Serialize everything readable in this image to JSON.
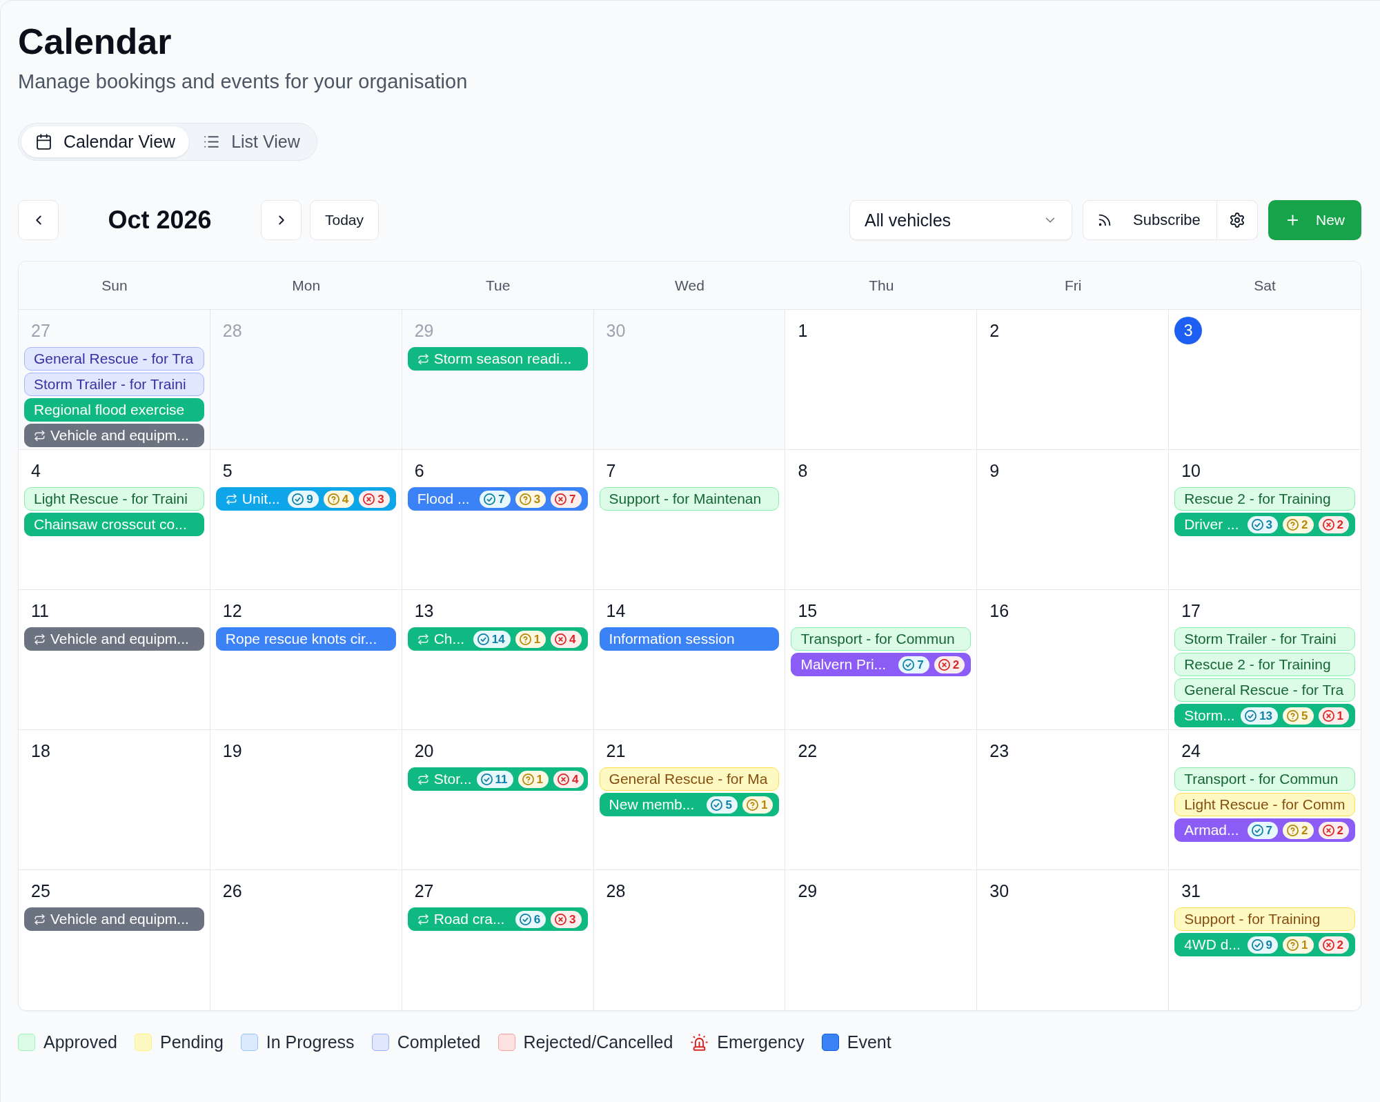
{
  "page": {
    "title": "Calendar",
    "subtitle": "Manage bookings and events for your organisation"
  },
  "view_toggle": [
    {
      "label": "Calendar View",
      "kind": "calendar",
      "selected": true
    },
    {
      "label": "List View",
      "kind": "list",
      "selected": false
    }
  ],
  "toolbar": {
    "month": "Oct 2026",
    "today_button": "Today",
    "vehicle_filter": {
      "value": "All vehicles"
    },
    "subscribe_button": "Subscribe",
    "new_button": "New"
  },
  "calendar": {
    "weekdays": [
      "Sun",
      "Mon",
      "Tue",
      "Wed",
      "Thu",
      "Fri",
      "Sat"
    ],
    "weeks": [
      {
        "days": [
          {
            "day": "27",
            "outside_month": true,
            "today": false,
            "items": [
              {
                "kind": "completed",
                "title": "General Rescue - for Tra",
                "recurring": false
              },
              {
                "kind": "completed",
                "title": "Storm Trailer - for Traini",
                "recurring": false
              },
              {
                "kind": "event",
                "color": "#10b981",
                "title": "Regional flood exercise",
                "recurring": false
              },
              {
                "kind": "event",
                "color": "#6b7280",
                "title": "Vehicle and equipm...",
                "recurring": true
              }
            ]
          },
          {
            "day": "28",
            "outside_month": true,
            "today": false
          },
          {
            "day": "29",
            "outside_month": true,
            "today": false,
            "items": [
              {
                "kind": "event",
                "color": "#10b981",
                "title": "Storm season readi...",
                "recurring": true
              }
            ]
          },
          {
            "day": "30",
            "outside_month": true,
            "today": false
          },
          {
            "day": "1",
            "outside_month": false,
            "today": false
          },
          {
            "day": "2",
            "outside_month": false,
            "today": false
          },
          {
            "day": "3",
            "outside_month": false,
            "today": true
          }
        ]
      },
      {
        "days": [
          {
            "day": "4",
            "outside_month": false,
            "today": false,
            "items": [
              {
                "kind": "approved",
                "title": "Light Rescue - for Traini",
                "recurring": false
              },
              {
                "kind": "event",
                "color": "#10b981",
                "title": "Chainsaw crosscut co...",
                "recurring": false
              }
            ]
          },
          {
            "day": "5",
            "outside_month": false,
            "today": false,
            "items": [
              {
                "kind": "event",
                "color": "#0ea5e9",
                "title": "Unit...",
                "recurring": true,
                "counts": [
                  {
                    "kind": "approved",
                    "count": "9"
                  },
                  {
                    "kind": "pending",
                    "count": "4"
                  },
                  {
                    "kind": "rejected",
                    "count": "3"
                  }
                ]
              }
            ]
          },
          {
            "day": "6",
            "outside_month": false,
            "today": false,
            "items": [
              {
                "kind": "event",
                "color": "#3b82f6",
                "title": "Flood ...",
                "recurring": false,
                "counts": [
                  {
                    "kind": "approved",
                    "count": "7"
                  },
                  {
                    "kind": "pending",
                    "count": "3"
                  },
                  {
                    "kind": "rejected",
                    "count": "7"
                  }
                ]
              }
            ]
          },
          {
            "day": "7",
            "outside_month": false,
            "today": false,
            "items": [
              {
                "kind": "approved",
                "title": "Support - for Maintenan",
                "recurring": false
              }
            ]
          },
          {
            "day": "8",
            "outside_month": false,
            "today": false
          },
          {
            "day": "9",
            "outside_month": false,
            "today": false
          },
          {
            "day": "10",
            "outside_month": false,
            "today": false,
            "items": [
              {
                "kind": "approved",
                "title": "Rescue 2 - for Training",
                "recurring": false
              },
              {
                "kind": "event",
                "color": "#10b981",
                "title": "Driver ...",
                "recurring": false,
                "counts": [
                  {
                    "kind": "approved",
                    "count": "3"
                  },
                  {
                    "kind": "pending",
                    "count": "2"
                  },
                  {
                    "kind": "rejected",
                    "count": "2"
                  }
                ]
              }
            ]
          }
        ]
      },
      {
        "days": [
          {
            "day": "11",
            "outside_month": false,
            "today": false,
            "items": [
              {
                "kind": "event",
                "color": "#6b7280",
                "title": "Vehicle and equipm...",
                "recurring": true
              }
            ]
          },
          {
            "day": "12",
            "outside_month": false,
            "today": false,
            "items": [
              {
                "kind": "event",
                "color": "#3b82f6",
                "title": "Rope rescue knots cir...",
                "recurring": false
              }
            ]
          },
          {
            "day": "13",
            "outside_month": false,
            "today": false,
            "items": [
              {
                "kind": "event",
                "color": "#10b981",
                "title": "Ch...",
                "recurring": true,
                "counts": [
                  {
                    "kind": "approved",
                    "count": "14"
                  },
                  {
                    "kind": "pending",
                    "count": "1"
                  },
                  {
                    "kind": "rejected",
                    "count": "4"
                  }
                ]
              }
            ]
          },
          {
            "day": "14",
            "outside_month": false,
            "today": false,
            "items": [
              {
                "kind": "event",
                "color": "#3b82f6",
                "title": "Information session",
                "recurring": false
              }
            ]
          },
          {
            "day": "15",
            "outside_month": false,
            "today": false,
            "items": [
              {
                "kind": "approved",
                "title": "Transport - for Commun",
                "recurring": false
              },
              {
                "kind": "event",
                "color": "#8b5cf6",
                "title": "Malvern Pri...",
                "recurring": false,
                "counts": [
                  {
                    "kind": "approved",
                    "count": "7"
                  },
                  {
                    "kind": "rejected",
                    "count": "2"
                  }
                ]
              }
            ]
          },
          {
            "day": "16",
            "outside_month": false,
            "today": false
          },
          {
            "day": "17",
            "outside_month": false,
            "today": false,
            "items": [
              {
                "kind": "approved",
                "title": "Storm Trailer - for Traini",
                "recurring": false
              },
              {
                "kind": "approved",
                "title": "Rescue 2 - for Training",
                "recurring": false
              },
              {
                "kind": "approved",
                "title": "General Rescue - for Tra",
                "recurring": false
              },
              {
                "kind": "event",
                "color": "#10b981",
                "title": "Storm...",
                "recurring": false,
                "counts": [
                  {
                    "kind": "approved",
                    "count": "13"
                  },
                  {
                    "kind": "pending",
                    "count": "5"
                  },
                  {
                    "kind": "rejected",
                    "count": "1"
                  }
                ]
              }
            ]
          }
        ]
      },
      {
        "days": [
          {
            "day": "18",
            "outside_month": false,
            "today": false
          },
          {
            "day": "19",
            "outside_month": false,
            "today": false
          },
          {
            "day": "20",
            "outside_month": false,
            "today": false,
            "items": [
              {
                "kind": "event",
                "color": "#10b981",
                "title": "Stor...",
                "recurring": true,
                "counts": [
                  {
                    "kind": "approved",
                    "count": "11"
                  },
                  {
                    "kind": "pending",
                    "count": "1"
                  },
                  {
                    "kind": "rejected",
                    "count": "4"
                  }
                ]
              }
            ]
          },
          {
            "day": "21",
            "outside_month": false,
            "today": false,
            "items": [
              {
                "kind": "pending",
                "title": "General Rescue - for Ma",
                "recurring": false
              },
              {
                "kind": "event",
                "color": "#10b981",
                "title": "New memb...",
                "recurring": false,
                "counts": [
                  {
                    "kind": "approved",
                    "count": "5"
                  },
                  {
                    "kind": "pending",
                    "count": "1"
                  }
                ]
              }
            ]
          },
          {
            "day": "22",
            "outside_month": false,
            "today": false
          },
          {
            "day": "23",
            "outside_month": false,
            "today": false
          },
          {
            "day": "24",
            "outside_month": false,
            "today": false,
            "items": [
              {
                "kind": "approved",
                "title": "Transport - for Commun",
                "recurring": false
              },
              {
                "kind": "pending",
                "title": "Light Rescue - for Comm",
                "recurring": false
              },
              {
                "kind": "event",
                "color": "#8b5cf6",
                "title": "Armad...",
                "recurring": false,
                "counts": [
                  {
                    "kind": "approved",
                    "count": "7"
                  },
                  {
                    "kind": "pending",
                    "count": "2"
                  },
                  {
                    "kind": "rejected",
                    "count": "2"
                  }
                ]
              }
            ]
          }
        ]
      },
      {
        "days": [
          {
            "day": "25",
            "outside_month": false,
            "today": false,
            "items": [
              {
                "kind": "event",
                "color": "#6b7280",
                "title": "Vehicle and equipm...",
                "recurring": true
              }
            ]
          },
          {
            "day": "26",
            "outside_month": false,
            "today": false
          },
          {
            "day": "27",
            "outside_month": false,
            "today": false,
            "items": [
              {
                "kind": "event",
                "color": "#10b981",
                "title": "Road cra...",
                "recurring": true,
                "counts": [
                  {
                    "kind": "approved",
                    "count": "6"
                  },
                  {
                    "kind": "rejected",
                    "count": "3"
                  }
                ]
              }
            ]
          },
          {
            "day": "28",
            "outside_month": false,
            "today": false
          },
          {
            "day": "29",
            "outside_month": false,
            "today": false
          },
          {
            "day": "30",
            "outside_month": false,
            "today": false
          },
          {
            "day": "31",
            "outside_month": false,
            "today": false,
            "items": [
              {
                "kind": "pending",
                "title": "Support - for Training",
                "recurring": false
              },
              {
                "kind": "event",
                "color": "#10b981",
                "title": "4WD d...",
                "recurring": false,
                "counts": [
                  {
                    "kind": "approved",
                    "count": "9"
                  },
                  {
                    "kind": "pending",
                    "count": "1"
                  },
                  {
                    "kind": "rejected",
                    "count": "2"
                  }
                ]
              }
            ]
          }
        ]
      }
    ]
  },
  "legend": [
    {
      "label": "Approved",
      "kind": "swatch",
      "color": "#dcfce7"
    },
    {
      "label": "Pending",
      "kind": "swatch",
      "color": "#fef9c3"
    },
    {
      "label": "In Progress",
      "kind": "swatch",
      "color": "#dbeafe"
    },
    {
      "label": "Completed",
      "kind": "swatch",
      "color": "#e0e7ff"
    },
    {
      "label": "Rejected/Cancelled",
      "kind": "swatch",
      "color": "#fee2e2"
    },
    {
      "label": "Emergency",
      "kind": "siren"
    },
    {
      "label": "Event",
      "kind": "swatch",
      "color": "#3b82f6"
    }
  ]
}
